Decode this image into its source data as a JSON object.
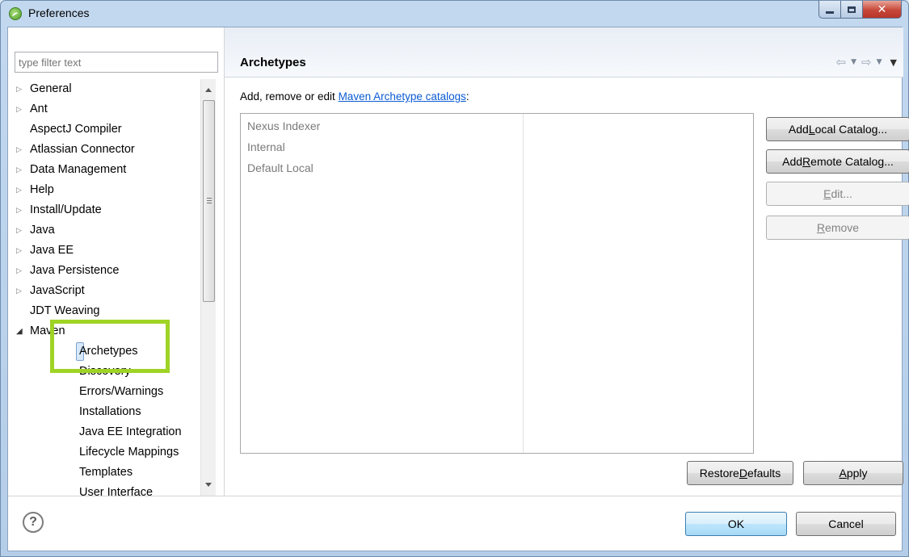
{
  "window": {
    "title": "Preferences"
  },
  "filter": {
    "placeholder": "type filter text"
  },
  "tree": {
    "items": [
      {
        "label": "General",
        "arrow": "▷"
      },
      {
        "label": "Ant",
        "arrow": "▷"
      },
      {
        "label": "AspectJ Compiler",
        "arrow": ""
      },
      {
        "label": "Atlassian Connector",
        "arrow": "▷"
      },
      {
        "label": "Data Management",
        "arrow": "▷"
      },
      {
        "label": "Help",
        "arrow": "▷"
      },
      {
        "label": "Install/Update",
        "arrow": "▷"
      },
      {
        "label": "Java",
        "arrow": "▷"
      },
      {
        "label": "Java EE",
        "arrow": "▷"
      },
      {
        "label": "Java Persistence",
        "arrow": "▷"
      },
      {
        "label": "JavaScript",
        "arrow": "▷"
      },
      {
        "label": "JDT Weaving",
        "arrow": ""
      },
      {
        "label": "Maven",
        "arrow": "◢"
      }
    ],
    "maven_children": [
      "Archetypes",
      "Discovery",
      "Errors/Warnings",
      "Installations",
      "Java EE Integration",
      "Lifecycle Mappings",
      "Templates",
      "User Interface"
    ]
  },
  "page": {
    "title": "Archetypes",
    "description_prefix": "Add, remove or edit ",
    "description_link": "Maven Archetype catalogs",
    "description_suffix": ":",
    "catalogs": [
      "Nexus Indexer",
      "Internal",
      "Default Local"
    ]
  },
  "buttons": {
    "add_local_pre": "Add ",
    "add_local_u": "L",
    "add_local_post": "ocal Catalog...",
    "add_remote_pre": "Add ",
    "add_remote_u": "R",
    "add_remote_post": "emote Catalog...",
    "edit_u": "E",
    "edit_post": "dit...",
    "remove_u": "R",
    "remove_post": "emove",
    "restore_pre": "Restore ",
    "restore_u": "D",
    "restore_post": "efaults",
    "apply_u": "A",
    "apply_post": "pply",
    "ok": "OK",
    "cancel": "Cancel"
  },
  "icons": {
    "nav_back": "⇦",
    "nav_forward": "⇨",
    "dropdown": "▼",
    "help": "?"
  },
  "colors": {
    "highlight": "#9fd325",
    "link": "#0b5bd3"
  }
}
